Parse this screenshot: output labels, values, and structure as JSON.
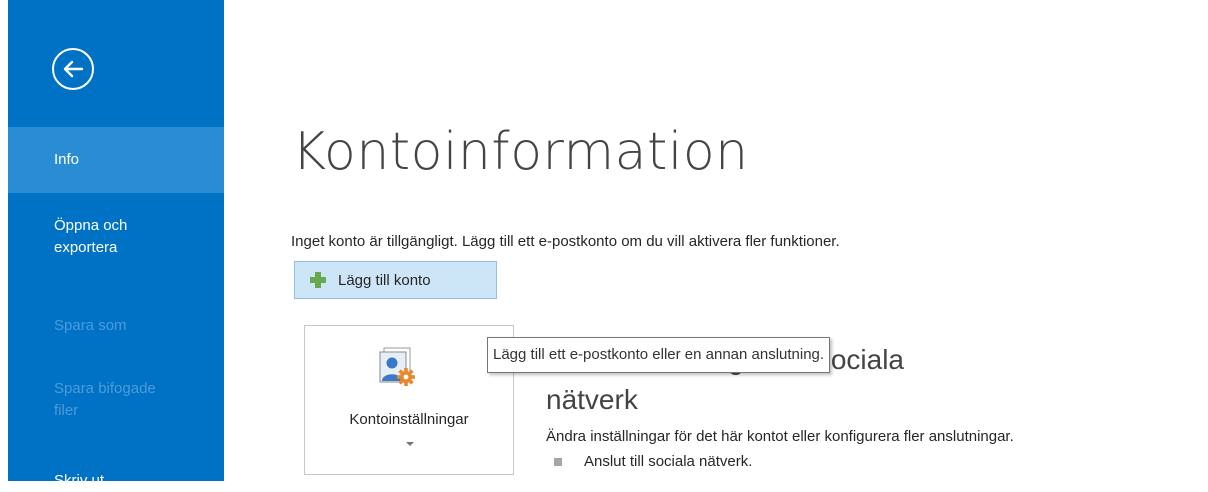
{
  "nav": {
    "items": [
      {
        "label": "Info"
      },
      {
        "label": "Öppna och exportera"
      },
      {
        "label": "Spara som"
      },
      {
        "label": "Spara bifogade filer"
      },
      {
        "label": "Skriv ut"
      }
    ]
  },
  "main": {
    "title": "Kontoinformation",
    "description": "Inget konto är tillgängligt. Lägg till ett e-postkonto om du vill aktivera fler funktioner.",
    "add_account_label": "Lägg till konto",
    "settings_tile_label": "Kontoinställningar",
    "section_heading_line1": "Kontoinställningar för sociala",
    "section_heading_line2": "nätverk",
    "section_description": "Ändra inställningar för det här kontot eller konfigurera fler anslutningar.",
    "bullet": "Anslut till sociala nätverk."
  },
  "tooltip": {
    "text": "Lägg till ett e-postkonto eller en annan anslutning."
  },
  "colors": {
    "nav_bg": "#0072c6",
    "nav_selected": "#2a8dd4",
    "add_button_bg": "#cde6f7",
    "plus_green": "#6aa84f",
    "gear_orange": "#e8882b"
  }
}
